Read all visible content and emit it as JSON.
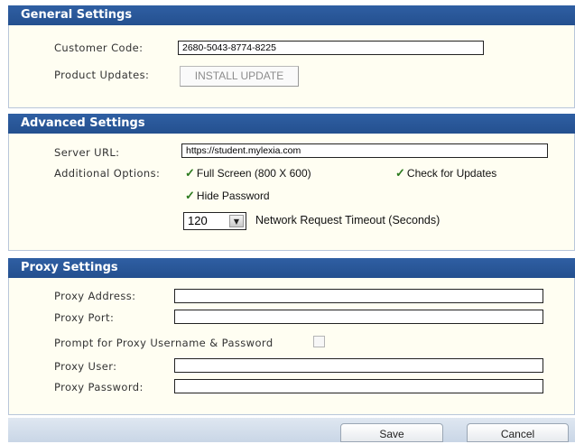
{
  "general": {
    "title": "General Settings",
    "customer_code_label": "Customer Code:",
    "customer_code_value": "2680-5043-8774-8225",
    "product_updates_label": "Product Updates:",
    "install_update_label": "INSTALL UPDATE"
  },
  "advanced": {
    "title": "Advanced Settings",
    "server_url_label": "Server URL:",
    "server_url_value": "https://student.mylexia.com",
    "additional_options_label": "Additional Options:",
    "full_screen_label": "Full Screen (800 X 600)",
    "check_updates_label": "Check for Updates",
    "hide_password_label": "Hide Password",
    "timeout_value": "120",
    "timeout_label": "Network Request Timeout (Seconds)"
  },
  "proxy": {
    "title": "Proxy Settings",
    "address_label": "Proxy Address:",
    "port_label": "Proxy Port:",
    "prompt_label": "Prompt for Proxy Username & Password",
    "user_label": "Proxy User:",
    "password_label": "Proxy Password:"
  },
  "footer": {
    "save_label": "Save",
    "cancel_label": "Cancel"
  },
  "colors": {
    "header_blue": "#2f5fa3",
    "panel_background": "#fffef2",
    "checkmark_green": "#2b7a1e"
  }
}
